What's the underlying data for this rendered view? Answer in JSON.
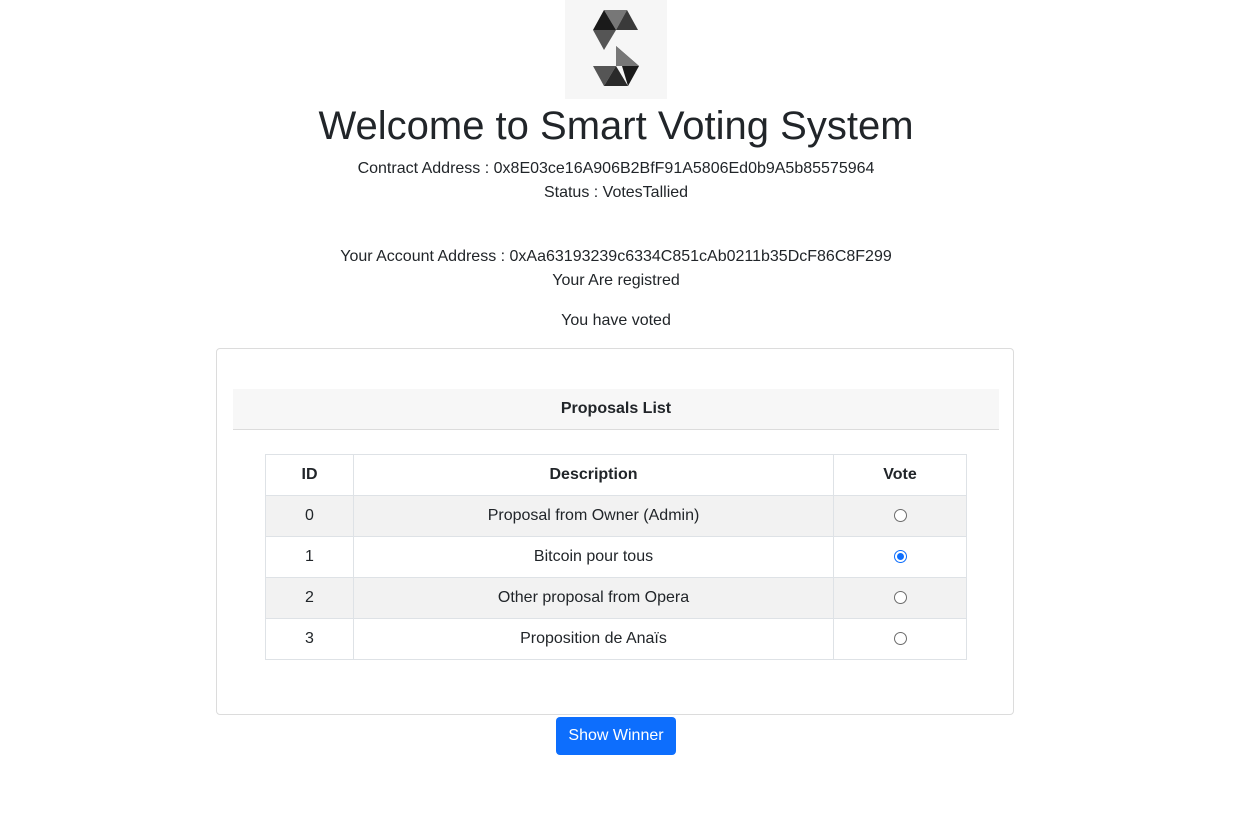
{
  "header": {
    "logo_icon": "solidity-logo-icon",
    "title": "Welcome to Smart Voting System",
    "contract_address": "Contract Address : 0x8E03ce16A906B2BfF91A5806Ed0b9A5b85575964",
    "status": "Status : VotesTallied"
  },
  "account": {
    "address": "Your Account Address : 0xAa63193239c6334C851cAb0211b35DcF86C8F299",
    "registration": "Your Are registred",
    "vote_status": "You have voted"
  },
  "proposals": {
    "heading": "Proposals List",
    "columns": [
      "ID",
      "Description",
      "Vote"
    ],
    "rows": [
      {
        "id": "0",
        "description": "Proposal from Owner (Admin)",
        "selected": false
      },
      {
        "id": "1",
        "description": "Bitcoin pour tous",
        "selected": true
      },
      {
        "id": "2",
        "description": "Other proposal from Opera",
        "selected": false
      },
      {
        "id": "3",
        "description": "Proposition de Anaïs",
        "selected": false
      }
    ]
  },
  "actions": {
    "show_winner_label": "Show Winner"
  },
  "colors": {
    "primary": "#0d6efd",
    "text": "#212529",
    "striped_row": "#f2f2f2"
  }
}
